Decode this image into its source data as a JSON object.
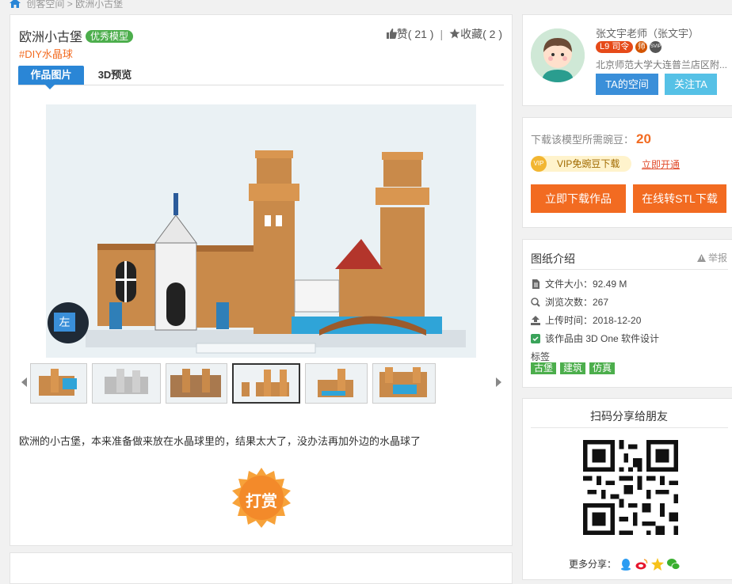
{
  "breadcrumb": {
    "home": "创客空间",
    "separator": ">",
    "current": "欧洲小古堡"
  },
  "work": {
    "title": "欧洲小古堡",
    "badge": "优秀模型",
    "tag": "#DIY水晶球",
    "like_label": "赞",
    "like_count": "( 21 )",
    "separator": "|",
    "collect_label": "收藏",
    "collect_count": "( 2 )",
    "tabs": [
      "作品图片",
      "3D预览"
    ],
    "viewer_side_label": "左",
    "description": "欧洲的小古堡，本来准备做来放在水晶球里的，结果太大了，没办法再加外边的水晶球了",
    "tip_label": "打赏"
  },
  "author": {
    "name": "张文宇老师（张文宇）",
    "level": "L9",
    "role": "司令",
    "badge_teacher": "师",
    "badge_vip": "SVIP",
    "address": "北京师范大学大连普兰店区附...",
    "space_button": "TA的空间",
    "follow_button": "关注TA"
  },
  "download": {
    "label": "下载该模型所需豌豆：",
    "cost": "20",
    "vip_icon": "VIP",
    "vip_text": "VIP免豌豆下载",
    "vip_link": "立即开通",
    "download_button": "立即下载作品",
    "stl_button": "在线转STL下载"
  },
  "info": {
    "title": "图纸介绍",
    "report": "举报",
    "rows": [
      {
        "icon": "file-icon",
        "text": "文件大小：92.49 M"
      },
      {
        "icon": "eye-icon",
        "text": "浏览次数：267"
      },
      {
        "icon": "upload-icon",
        "text": "上传时间：2018-12-20"
      },
      {
        "icon": "software-icon",
        "text": "该作品由 3D One 软件设计"
      }
    ],
    "tags_label": "标签",
    "tags": [
      "古堡",
      "建筑",
      "仿真"
    ]
  },
  "share": {
    "title": "扫码分享给朋友",
    "more": "更多分享："
  },
  "colors": {
    "accent": "#2a86d6",
    "orange": "#f26b21",
    "green": "#4cae4c"
  }
}
